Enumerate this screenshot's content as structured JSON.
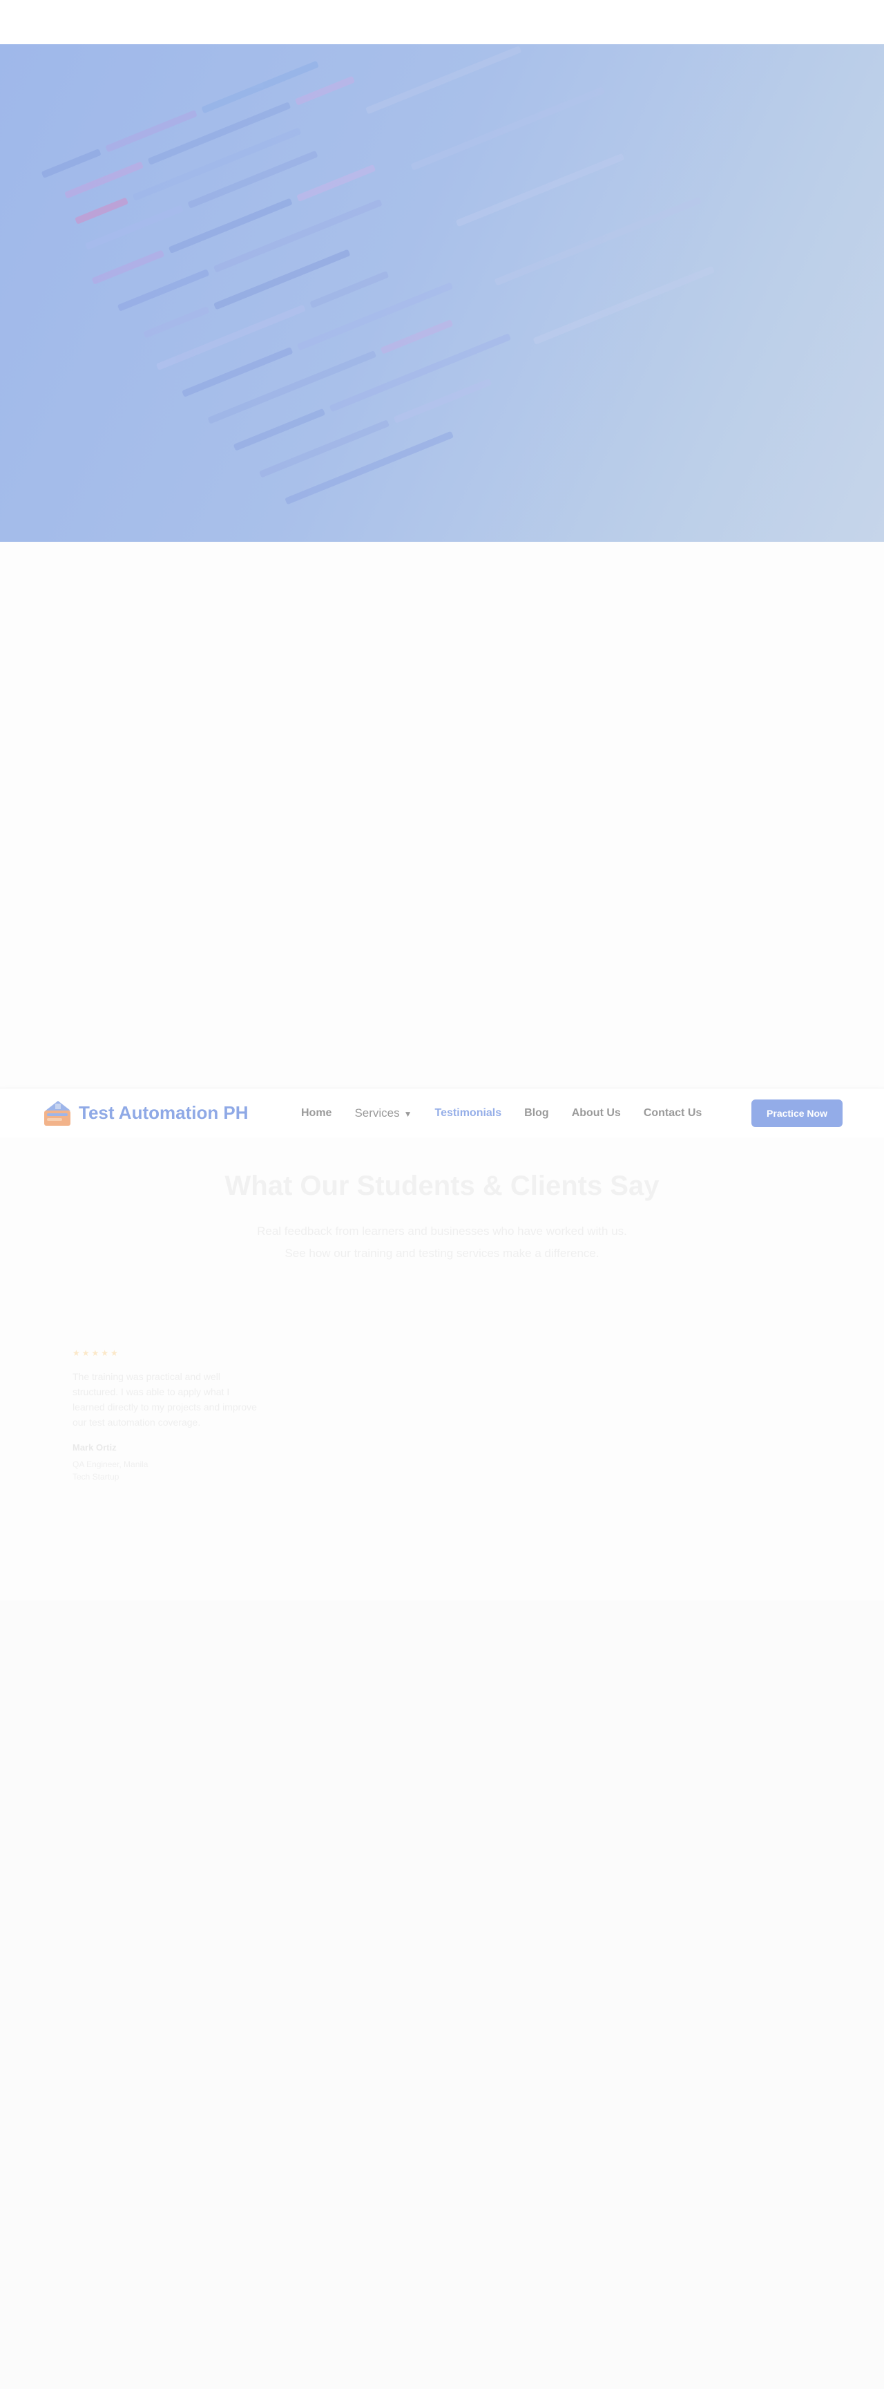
{
  "brand": {
    "name": "Test Automation PH",
    "color": "#8fa9e6"
  },
  "nav": {
    "items": [
      {
        "label": "Home"
      },
      {
        "label": "Services",
        "icon": "chevron-down-icon"
      },
      {
        "label": "Testimonials",
        "active": true
      },
      {
        "label": "Blog"
      },
      {
        "label": "About Us"
      },
      {
        "label": "Contact Us"
      }
    ],
    "cta_label": "Practice Now",
    "accent_color": "#93ace8"
  },
  "testimonials": {
    "title": "What Our Students & Clients Say",
    "subtitle": "Real feedback from learners and businesses who have worked with us. See how our training and testing services make a difference.",
    "card": {
      "stars": "★★★★★",
      "quote": "The training was practical and well structured. I was able to apply what I learned directly to my projects and improve our test automation coverage.",
      "author": "Mark Ortiz",
      "role_line1": "QA Engineer, Manila",
      "role_line2": "Tech Startup"
    }
  },
  "hero": {
    "image": "code-screenshot-background"
  }
}
